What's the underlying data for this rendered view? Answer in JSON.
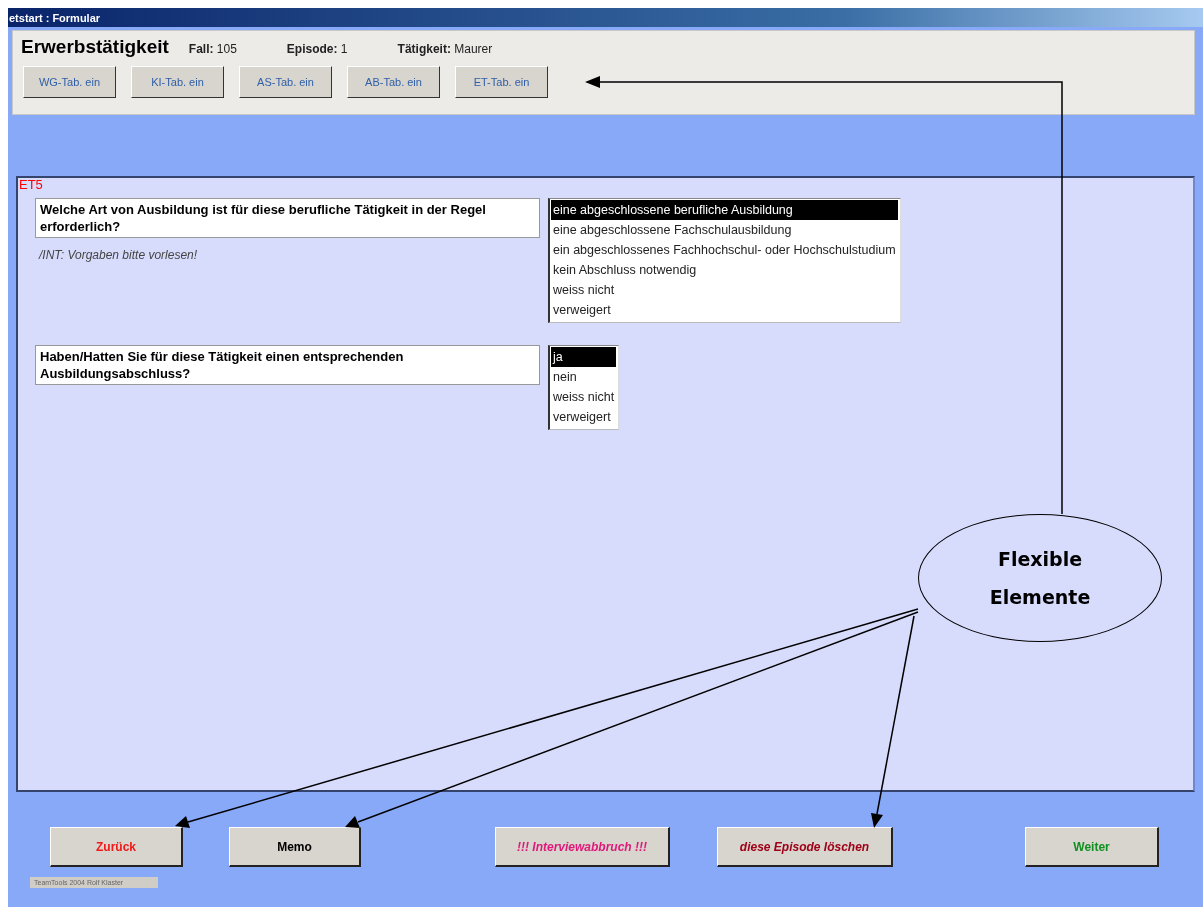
{
  "window": {
    "title": "etstart : Formular"
  },
  "header": {
    "title": "Erwerbstätigkeit",
    "fields": [
      {
        "label": "Fall:",
        "value": "105"
      },
      {
        "label": "Episode:",
        "value": "1"
      },
      {
        "label": "Tätigkeit:",
        "value": "Maurer"
      }
    ],
    "buttons": [
      "WG-Tab. ein",
      "KI-Tab. ein",
      "AS-Tab. ein",
      "AB-Tab. ein",
      "ET-Tab. ein"
    ]
  },
  "panel": {
    "code": "ET5",
    "questions": [
      {
        "text": "Welche Art von Ausbildung ist für diese berufliche Tätigkeit in der Regel erforderlich?",
        "hint": "/INT: Vorgaben bitte vorlesen!",
        "options": [
          {
            "label": "eine abgeschlossene berufliche Ausbildung",
            "selected": true
          },
          {
            "label": "eine abgeschlossene Fachschulausbildung",
            "selected": false
          },
          {
            "label": "ein abgeschlossenes Fachhochschul- oder Hochschulstudium",
            "selected": false
          },
          {
            "label": "kein Abschluss notwendig",
            "selected": false
          },
          {
            "label": "weiss nicht",
            "selected": false
          },
          {
            "label": "verweigert",
            "selected": false
          }
        ]
      },
      {
        "text": "Haben/Hatten Sie für diese Tätigkeit einen entsprechenden Ausbildungsabschluss?",
        "options": [
          {
            "label": "ja",
            "selected": true
          },
          {
            "label": "nein",
            "selected": false
          },
          {
            "label": "weiss nicht",
            "selected": false
          },
          {
            "label": "verweigert",
            "selected": false
          }
        ]
      }
    ]
  },
  "footer": {
    "buttons": [
      {
        "label": "Zurück",
        "color": "#f01818",
        "kind": "plain"
      },
      {
        "label": "Memo",
        "color": "#000000",
        "kind": "plain"
      },
      {
        "label": "!!! Interviewabbruch !!!",
        "color": "#e0187a",
        "kind": "italic"
      },
      {
        "label": "diese Episode löschen",
        "color": "#a00018",
        "kind": "italic"
      },
      {
        "label": "Weiter",
        "color": "#109020",
        "kind": "plain"
      }
    ],
    "credit": "TeamTools 2004 Rolf Klaster"
  },
  "annotation": {
    "label": "Flexible Elemente"
  }
}
